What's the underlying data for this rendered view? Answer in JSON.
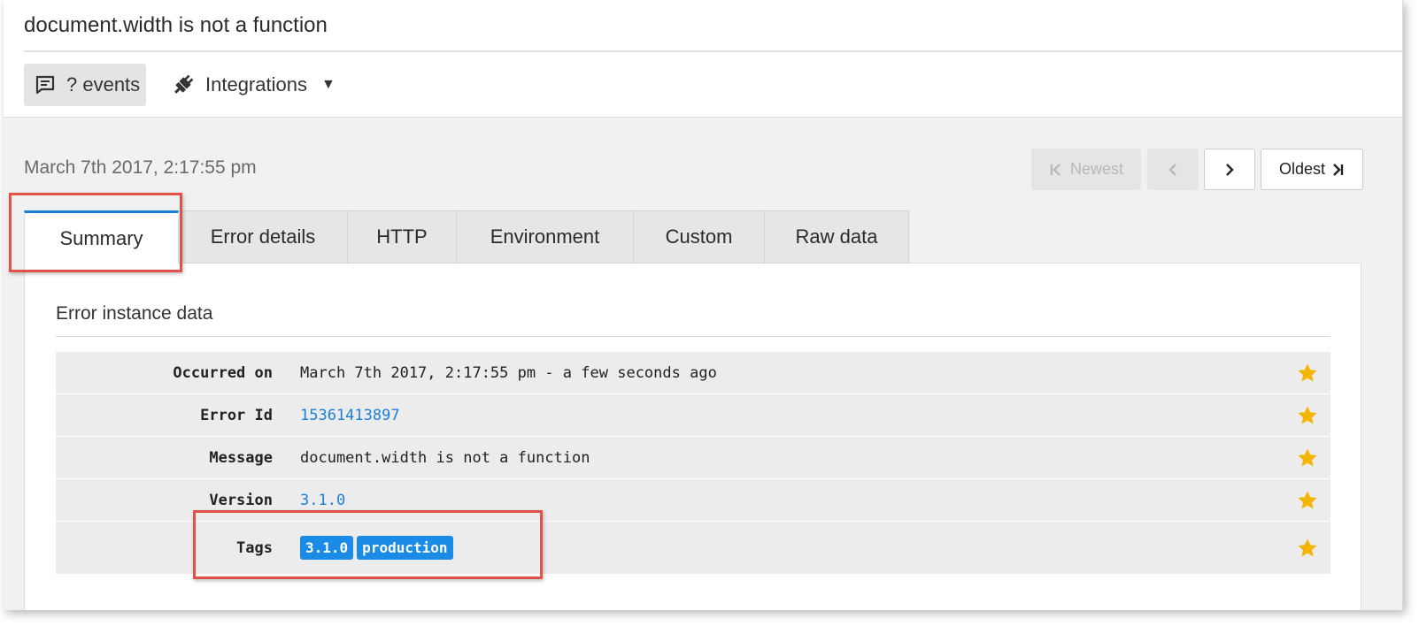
{
  "header": {
    "title": "document.width is not a function",
    "events_label": "? events",
    "integrations_label": "Integrations"
  },
  "event": {
    "date": "March 7th 2017, 2:17:55 pm"
  },
  "pager": {
    "newest": "Newest",
    "oldest": "Oldest"
  },
  "tabs": [
    {
      "label": "Summary",
      "active": true
    },
    {
      "label": "Error details"
    },
    {
      "label": "HTTP"
    },
    {
      "label": "Environment"
    },
    {
      "label": "Custom"
    },
    {
      "label": "Raw data"
    }
  ],
  "summary": {
    "section_title": "Error instance data",
    "rows": [
      {
        "key": "Occurred on",
        "value": "March 7th 2017, 2:17:55 pm - a few seconds ago"
      },
      {
        "key": "Error Id",
        "value": "15361413897"
      },
      {
        "key": "Message",
        "value": "document.width is not a function"
      },
      {
        "key": "Version",
        "value": "3.1.0"
      },
      {
        "key": "Tags",
        "tags": [
          "3.1.0",
          "production"
        ]
      }
    ]
  },
  "colors": {
    "accent": "#1a7fd8",
    "tag_bg": "#1a8be6",
    "star": "#f5b400",
    "highlight": "#e0524a"
  }
}
